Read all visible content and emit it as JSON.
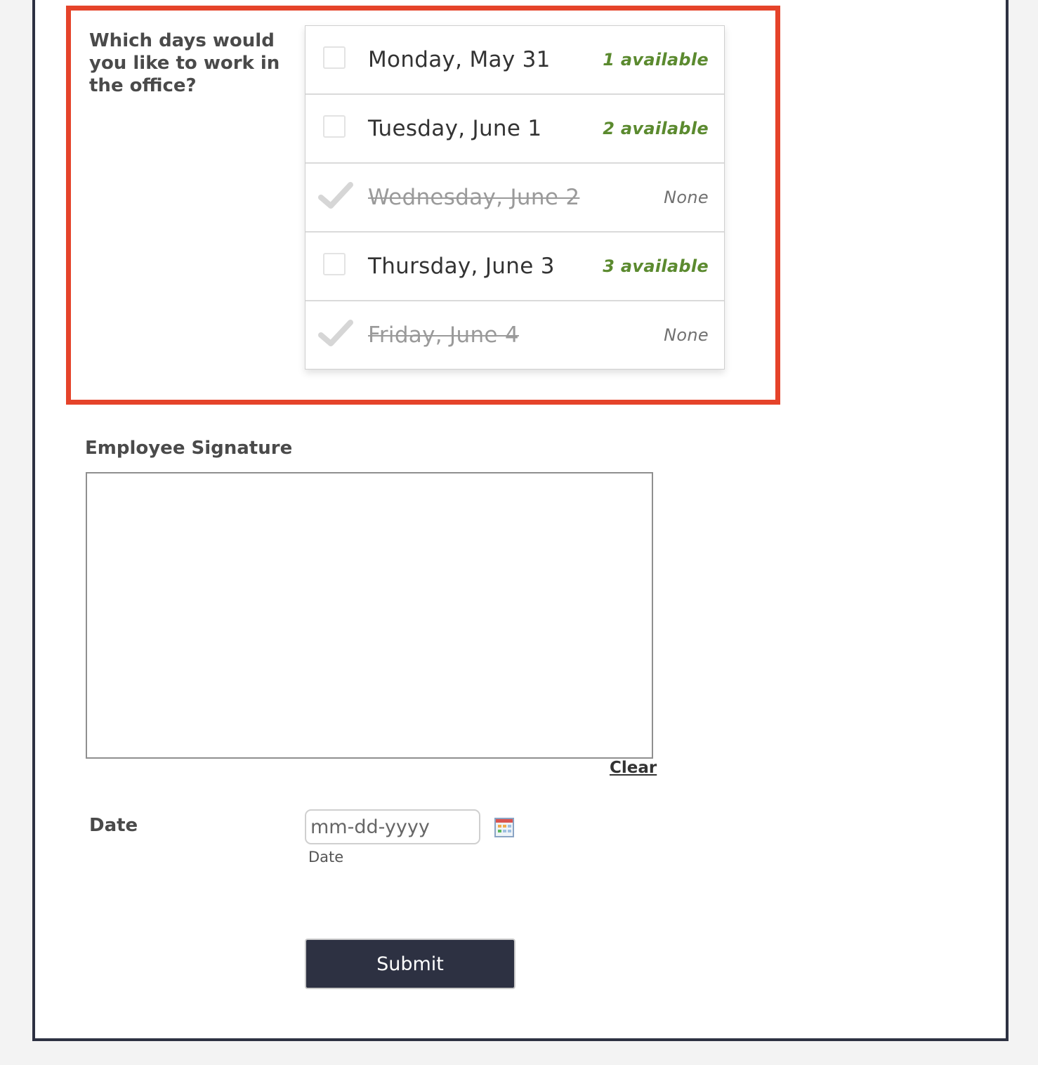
{
  "question": {
    "label": "Which days would you like to work in the office?",
    "options": [
      {
        "label": "Monday, May 31",
        "availability": "1 available",
        "disabled": false
      },
      {
        "label": "Tuesday, June 1",
        "availability": "2 available",
        "disabled": false
      },
      {
        "label": "Wednesday, June 2",
        "availability": "None",
        "disabled": true
      },
      {
        "label": "Thursday, June 3",
        "availability": "3 available",
        "disabled": false
      },
      {
        "label": "Friday, June 4",
        "availability": "None",
        "disabled": true
      }
    ]
  },
  "signature": {
    "label": "Employee Signature",
    "clear_label": "Clear"
  },
  "date": {
    "label": "Date",
    "placeholder": "mm-dd-yyyy",
    "sublabel": "Date",
    "icon": "calendar-icon"
  },
  "submit": {
    "label": "Submit"
  },
  "colors": {
    "highlight": "#e5432a",
    "available": "#5b8a2f",
    "button": "#2d3142",
    "frame": "#2d3142"
  }
}
